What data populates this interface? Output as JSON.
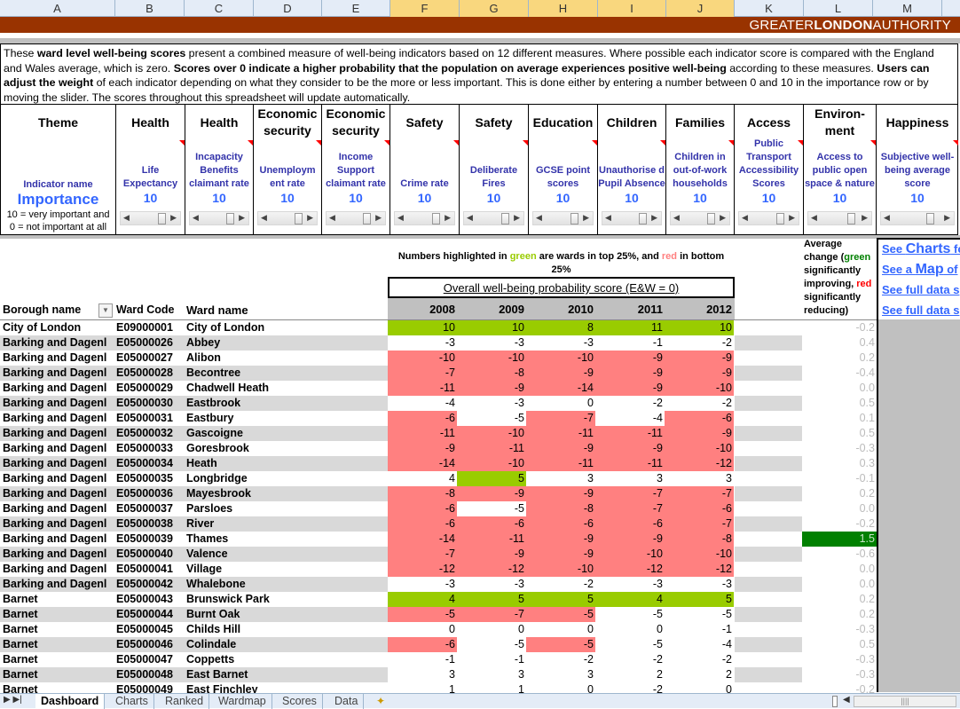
{
  "column_headers": [
    "A",
    "B",
    "C",
    "D",
    "E",
    "F",
    "G",
    "H",
    "I",
    "J",
    "K",
    "L",
    "M"
  ],
  "selected_columns": [
    "F",
    "G",
    "H",
    "I",
    "J"
  ],
  "banner": {
    "brand_part1": "GREATER",
    "brand_part2": "LONDON",
    "brand_part3": "AUTHORITY",
    "bg_color": "#993300"
  },
  "intro": {
    "t1": "These ",
    "b1": "ward level well-being scores",
    "t2": " present a combined measure of well-being indicators based on 12 different measures. Where possible each indicator score is compared with the England and Wales average, which is zero. ",
    "b2": "Scores over 0 indicate a higher probability that the population on average experiences positive well-being",
    "t3": " according to these measures. ",
    "b3": "Users can adjust the weight",
    "t4": " of each indicator depending on what they consider to be the more or less important. This is done either by entering a number between 0 and 10 in the importance row or by moving the slider. The scores throughout this spreadsheet will update automatically."
  },
  "indicator_panel": {
    "theme_label": "Theme",
    "indicator_label": "Indicator name",
    "importance_label": "Importance",
    "scale_note_1": "10 = very important and",
    "scale_note_2": "0 = not important at all",
    "indicators": [
      {
        "theme": "Health",
        "name": "Life Expectancy",
        "importance": "10"
      },
      {
        "theme": "Health",
        "name": "Incapacity Benefits claimant rate",
        "importance": "10"
      },
      {
        "theme": "Economic security",
        "name": "Unemploym ent rate",
        "importance": "10"
      },
      {
        "theme": "Economic security",
        "name": "Income Support claimant rate",
        "importance": "10"
      },
      {
        "theme": "Safety",
        "name": "Crime rate",
        "importance": "10"
      },
      {
        "theme": "Safety",
        "name": "Deliberate Fires",
        "importance": "10"
      },
      {
        "theme": "Education",
        "name": "GCSE point scores",
        "importance": "10"
      },
      {
        "theme": "Children",
        "name": "Unauthorise d Pupil Absence",
        "importance": "10"
      },
      {
        "theme": "Families",
        "name": "Children in out-of-work households",
        "importance": "10"
      },
      {
        "theme": "Access",
        "name": "Public Transport Accessibility Scores",
        "importance": "10"
      },
      {
        "theme": "Environ- ment",
        "name": "Access to public open space & nature",
        "importance": "10"
      },
      {
        "theme": "Happiness",
        "name": "Subjective well-being average score",
        "importance": "10"
      }
    ]
  },
  "highlight_note": {
    "p1": "Numbers highlighted in ",
    "green_word": "green",
    "p2": " are wards in top 25%, and ",
    "red_word": "red",
    "p3": " in bottom 25%"
  },
  "overall_title": "Overall well-being probability score (E&W = 0)",
  "years": [
    "2008",
    "2009",
    "2010",
    "2011",
    "2012"
  ],
  "avg_note": {
    "p1": "Average change (",
    "green_word": "green",
    "p2": " significantly improving, ",
    "red_word": "red",
    "p3": " significantly reducing)"
  },
  "links": [
    {
      "pre": "See ",
      "big": "Charts",
      "post": " fo"
    },
    {
      "pre": "See a ",
      "big": "Map",
      "post": " of"
    },
    {
      "pre": "See full data s",
      "big": "",
      "post": ""
    },
    {
      "pre": "See full data s",
      "big": "",
      "post": ""
    }
  ],
  "list_headers": {
    "borough": "Borough name",
    "code": "Ward Code",
    "ward": "Ward name"
  },
  "colors": {
    "red": "#ff8080",
    "green": "#99cc00",
    "sig_green": "#008000"
  },
  "rows": [
    {
      "borough": "City of London",
      "code": "E09000001",
      "ward": "City of London",
      "scores": [
        10,
        10,
        8,
        11,
        10
      ],
      "flags": [
        "g",
        "g",
        "g",
        "g",
        "g"
      ],
      "avg": "-0.2",
      "avg_sig": ""
    },
    {
      "borough": "Barking and Dagenl",
      "code": "E05000026",
      "ward": "Abbey",
      "scores": [
        -3,
        -3,
        -3,
        -1,
        -2
      ],
      "flags": [
        "",
        "",
        "",
        "",
        ""
      ],
      "avg": "0.4",
      "avg_sig": ""
    },
    {
      "borough": "Barking and Dagenl",
      "code": "E05000027",
      "ward": "Alibon",
      "scores": [
        -10,
        -10,
        -10,
        -9,
        -9
      ],
      "flags": [
        "r",
        "r",
        "r",
        "r",
        "r"
      ],
      "avg": "0.2",
      "avg_sig": ""
    },
    {
      "borough": "Barking and Dagenl",
      "code": "E05000028",
      "ward": "Becontree",
      "scores": [
        -7,
        -8,
        -9,
        -9,
        -9
      ],
      "flags": [
        "r",
        "r",
        "r",
        "r",
        "r"
      ],
      "avg": "-0.4",
      "avg_sig": ""
    },
    {
      "borough": "Barking and Dagenl",
      "code": "E05000029",
      "ward": "Chadwell Heath",
      "scores": [
        -11,
        -9,
        -14,
        -9,
        -10
      ],
      "flags": [
        "r",
        "r",
        "r",
        "r",
        "r"
      ],
      "avg": "0.0",
      "avg_sig": ""
    },
    {
      "borough": "Barking and Dagenl",
      "code": "E05000030",
      "ward": "Eastbrook",
      "scores": [
        -4,
        -3,
        0,
        -2,
        -2
      ],
      "flags": [
        "",
        "",
        "",
        "",
        ""
      ],
      "avg": "0.5",
      "avg_sig": ""
    },
    {
      "borough": "Barking and Dagenl",
      "code": "E05000031",
      "ward": "Eastbury",
      "scores": [
        -6,
        -5,
        -7,
        -4,
        -6
      ],
      "flags": [
        "r",
        "",
        "r",
        "",
        "r"
      ],
      "avg": "0.1",
      "avg_sig": ""
    },
    {
      "borough": "Barking and Dagenl",
      "code": "E05000032",
      "ward": "Gascoigne",
      "scores": [
        -11,
        -10,
        -11,
        -11,
        -9
      ],
      "flags": [
        "r",
        "r",
        "r",
        "r",
        "r"
      ],
      "avg": "0.5",
      "avg_sig": ""
    },
    {
      "borough": "Barking and Dagenl",
      "code": "E05000033",
      "ward": "Goresbrook",
      "scores": [
        -9,
        -11,
        -9,
        -9,
        -10
      ],
      "flags": [
        "r",
        "r",
        "r",
        "r",
        "r"
      ],
      "avg": "-0.3",
      "avg_sig": ""
    },
    {
      "borough": "Barking and Dagenl",
      "code": "E05000034",
      "ward": "Heath",
      "scores": [
        -14,
        -10,
        -11,
        -11,
        -12
      ],
      "flags": [
        "r",
        "r",
        "r",
        "r",
        "r"
      ],
      "avg": "0.3",
      "avg_sig": ""
    },
    {
      "borough": "Barking and Dagenl",
      "code": "E05000035",
      "ward": "Longbridge",
      "scores": [
        4,
        5,
        3,
        3,
        3
      ],
      "flags": [
        "",
        "g",
        "",
        "",
        ""
      ],
      "avg": "-0.1",
      "avg_sig": ""
    },
    {
      "borough": "Barking and Dagenl",
      "code": "E05000036",
      "ward": "Mayesbrook",
      "scores": [
        -8,
        -9,
        -9,
        -7,
        -7
      ],
      "flags": [
        "r",
        "r",
        "r",
        "r",
        "r"
      ],
      "avg": "0.2",
      "avg_sig": ""
    },
    {
      "borough": "Barking and Dagenl",
      "code": "E05000037",
      "ward": "Parsloes",
      "scores": [
        -6,
        -5,
        -8,
        -7,
        -6
      ],
      "flags": [
        "r",
        "",
        "r",
        "r",
        "r"
      ],
      "avg": "0.0",
      "avg_sig": ""
    },
    {
      "borough": "Barking and Dagenl",
      "code": "E05000038",
      "ward": "River",
      "scores": [
        -6,
        -6,
        -6,
        -6,
        -7
      ],
      "flags": [
        "r",
        "r",
        "r",
        "r",
        "r"
      ],
      "avg": "-0.2",
      "avg_sig": ""
    },
    {
      "borough": "Barking and Dagenl",
      "code": "E05000039",
      "ward": "Thames",
      "scores": [
        -14,
        -11,
        -9,
        -9,
        -8
      ],
      "flags": [
        "r",
        "r",
        "r",
        "r",
        "r"
      ],
      "avg": "1.5",
      "avg_sig": "g"
    },
    {
      "borough": "Barking and Dagenl",
      "code": "E05000040",
      "ward": "Valence",
      "scores": [
        -7,
        -9,
        -9,
        -10,
        -10
      ],
      "flags": [
        "r",
        "r",
        "r",
        "r",
        "r"
      ],
      "avg": "-0.6",
      "avg_sig": ""
    },
    {
      "borough": "Barking and Dagenl",
      "code": "E05000041",
      "ward": "Village",
      "scores": [
        -12,
        -12,
        -10,
        -12,
        -12
      ],
      "flags": [
        "r",
        "r",
        "r",
        "r",
        "r"
      ],
      "avg": "0.0",
      "avg_sig": ""
    },
    {
      "borough": "Barking and Dagenl",
      "code": "E05000042",
      "ward": "Whalebone",
      "scores": [
        -3,
        -3,
        -2,
        -3,
        -3
      ],
      "flags": [
        "",
        "",
        "",
        "",
        ""
      ],
      "avg": "0.0",
      "avg_sig": ""
    },
    {
      "borough": "Barnet",
      "code": "E05000043",
      "ward": "Brunswick Park",
      "scores": [
        4,
        5,
        5,
        4,
        5
      ],
      "flags": [
        "g",
        "g",
        "g",
        "g",
        "g"
      ],
      "avg": "0.2",
      "avg_sig": ""
    },
    {
      "borough": "Barnet",
      "code": "E05000044",
      "ward": "Burnt Oak",
      "scores": [
        -5,
        -7,
        -5,
        -5,
        -5
      ],
      "flags": [
        "r",
        "r",
        "r",
        "",
        ""
      ],
      "avg": "0.2",
      "avg_sig": ""
    },
    {
      "borough": "Barnet",
      "code": "E05000045",
      "ward": "Childs Hill",
      "scores": [
        0,
        0,
        0,
        0,
        -1
      ],
      "flags": [
        "",
        "",
        "",
        "",
        ""
      ],
      "avg": "-0.3",
      "avg_sig": ""
    },
    {
      "borough": "Barnet",
      "code": "E05000046",
      "ward": "Colindale",
      "scores": [
        -6,
        -5,
        -5,
        -5,
        -4
      ],
      "flags": [
        "r",
        "",
        "r",
        "",
        ""
      ],
      "avg": "0.5",
      "avg_sig": ""
    },
    {
      "borough": "Barnet",
      "code": "E05000047",
      "ward": "Coppetts",
      "scores": [
        -1,
        -1,
        -2,
        -2,
        -2
      ],
      "flags": [
        "",
        "",
        "",
        "",
        ""
      ],
      "avg": "-0.3",
      "avg_sig": ""
    },
    {
      "borough": "Barnet",
      "code": "E05000048",
      "ward": "East Barnet",
      "scores": [
        3,
        3,
        3,
        2,
        2
      ],
      "flags": [
        "",
        "",
        "",
        "",
        ""
      ],
      "avg": "-0.3",
      "avg_sig": ""
    },
    {
      "borough": "Barnet",
      "code": "E05000049",
      "ward": "East Finchley",
      "scores": [
        1,
        1,
        0,
        -2,
        0
      ],
      "flags": [
        "",
        "",
        "",
        "",
        ""
      ],
      "avg": "-0.2",
      "avg_sig": ""
    }
  ],
  "sheet_tabs": [
    "Dashboard",
    "Charts",
    "Ranked",
    "Wardmap",
    "Scores",
    "Data"
  ],
  "active_tab": "Dashboard"
}
